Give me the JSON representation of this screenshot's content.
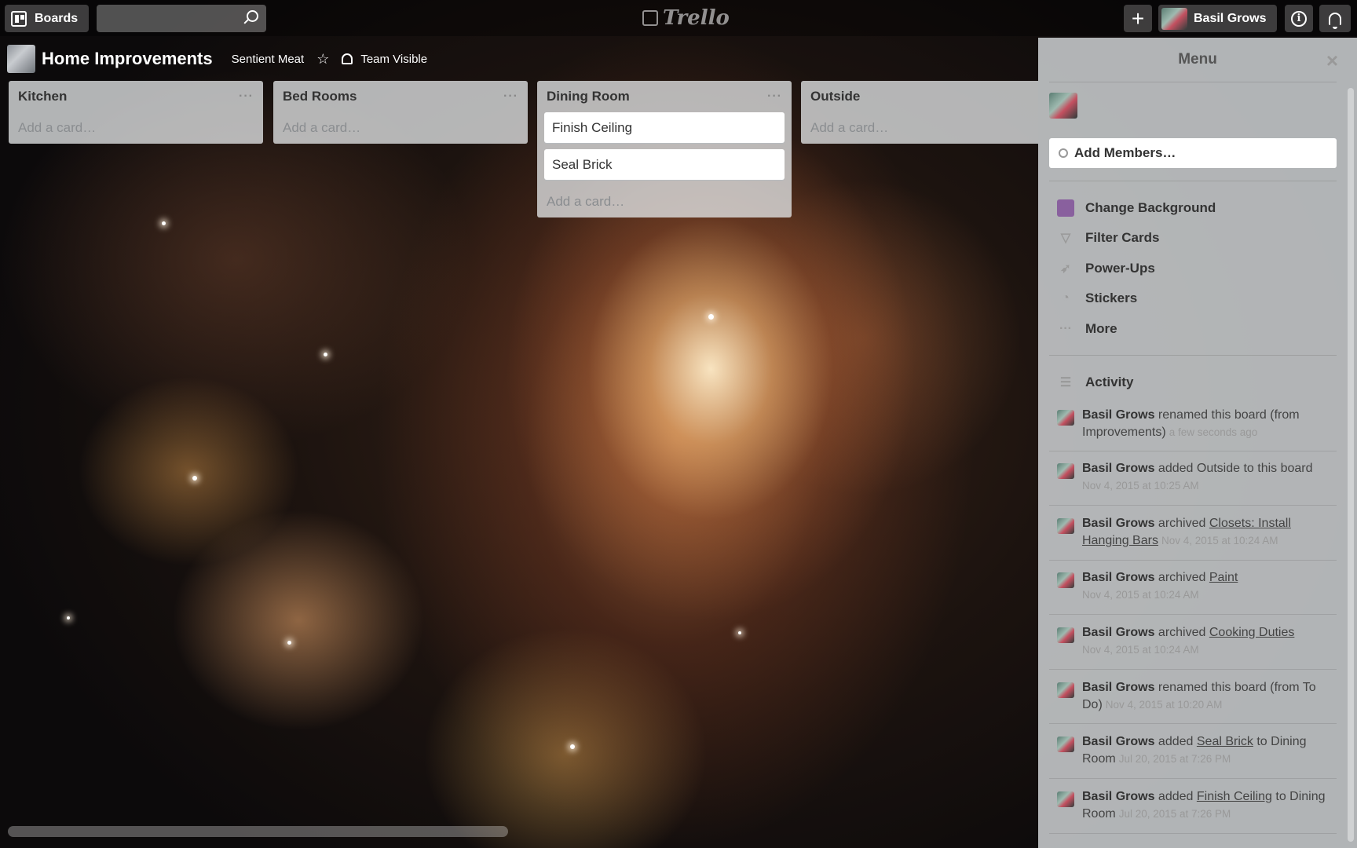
{
  "topbar": {
    "boards_label": "Boards",
    "search_value": "",
    "logo_text": "Trello",
    "user_name": "Basil Grows"
  },
  "board": {
    "title": "Home Improvements",
    "team": "Sentient Meat",
    "visibility": "Team Visible"
  },
  "lists": [
    {
      "name": "Kitchen",
      "cards": [],
      "add_card": "Add a card…"
    },
    {
      "name": "Bed Rooms",
      "cards": [],
      "add_card": "Add a card…"
    },
    {
      "name": "Dining Room",
      "cards": [
        "Finish Ceiling",
        "Seal Brick"
      ],
      "add_card": "Add a card…"
    },
    {
      "name": "Outside",
      "cards": [],
      "add_card": "Add a card…"
    }
  ],
  "menu": {
    "title": "Menu",
    "add_members": "Add Members…",
    "items": [
      {
        "label": "Change Background",
        "icon": "background-swatch-icon"
      },
      {
        "label": "Filter Cards",
        "icon": "filter-icon"
      },
      {
        "label": "Power-Ups",
        "icon": "rocket-icon"
      },
      {
        "label": "Stickers",
        "icon": "sticker-icon"
      },
      {
        "label": "More",
        "icon": "ellipsis-icon"
      }
    ],
    "activity_title": "Activity",
    "activity": [
      {
        "user": "Basil Grows",
        "pre": " renamed this board (from Improvements)",
        "link": "",
        "post": "",
        "time": "a few seconds ago"
      },
      {
        "user": "Basil Grows",
        "pre": " added Outside to this board",
        "link": "",
        "post": "",
        "time": "Nov 4, 2015 at 10:25 AM"
      },
      {
        "user": "Basil Grows",
        "pre": " archived ",
        "link": "Closets: Install Hanging Bars",
        "post": "",
        "time": "Nov 4, 2015 at 10:24 AM"
      },
      {
        "user": "Basil Grows",
        "pre": " archived ",
        "link": "Paint",
        "post": "",
        "time": "Nov 4, 2015 at 10:24 AM"
      },
      {
        "user": "Basil Grows",
        "pre": " archived ",
        "link": "Cooking Duties",
        "post": "",
        "time": "Nov 4, 2015 at 10:24 AM"
      },
      {
        "user": "Basil Grows",
        "pre": " renamed this board (from To Do)",
        "link": "",
        "post": "",
        "time": "Nov 4, 2015 at 10:20 AM"
      },
      {
        "user": "Basil Grows",
        "pre": " added ",
        "link": "Seal Brick",
        "post": " to Dining Room",
        "time": "Jul 20, 2015 at 7:26 PM"
      },
      {
        "user": "Basil Grows",
        "pre": " added ",
        "link": "Finish Ceiling",
        "post": " to Dining Room",
        "time": "Jul 20, 2015 at 7:26 PM"
      }
    ]
  },
  "colors": {
    "swatch": "#89609e",
    "list_bg": "#e2e4e6",
    "card_bg": "#ffffff"
  }
}
